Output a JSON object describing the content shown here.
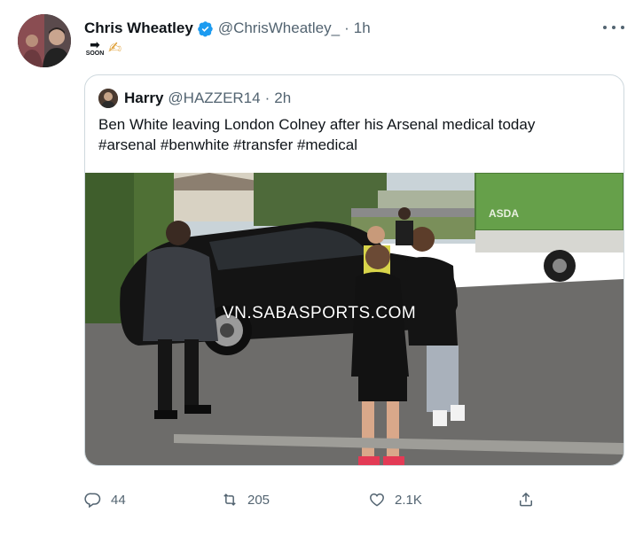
{
  "author": {
    "name": "Chris Wheatley",
    "handle": "@ChrisWheatley_",
    "time": "1h",
    "separator": "·"
  },
  "tweet": {
    "soon_label": "SOON",
    "soon_arrow": "➡",
    "writing_hand": "✍"
  },
  "quoted": {
    "name": "Harry",
    "handle": "@HAZZER14",
    "time": "2h",
    "separator": "·",
    "text_line1": "Ben White leaving London Colney after his Arsenal medical today",
    "text_line2": "#arsenal #benwhite #transfer #medical"
  },
  "watermark": "VN.SABASPORTS.COM",
  "truck_text": "ASDA",
  "actions": {
    "replies": "44",
    "retweets": "205",
    "likes": "2.1K"
  },
  "colors": {
    "verified": "#1d9bf0",
    "muted": "#536471",
    "border": "#cfd9de"
  },
  "icons": [
    "verified-badge-icon",
    "more-icon",
    "reply-icon",
    "retweet-icon",
    "like-icon",
    "share-icon"
  ]
}
